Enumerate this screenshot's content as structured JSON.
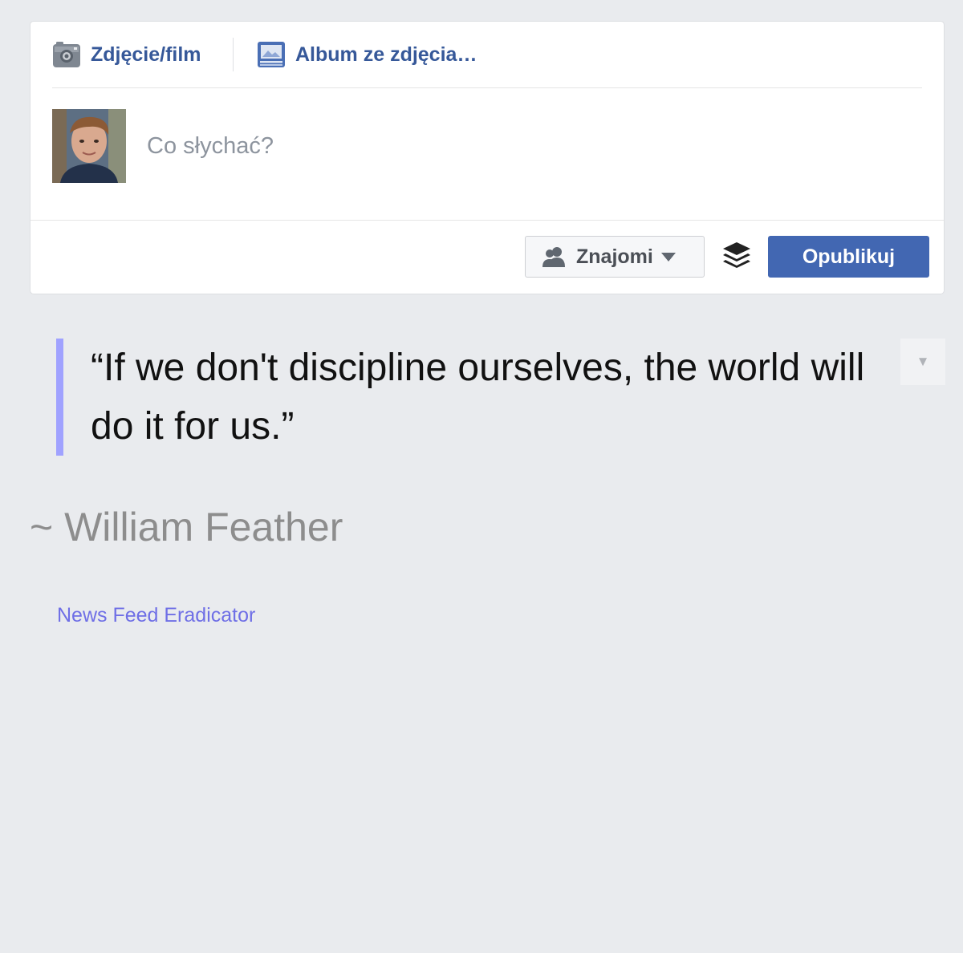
{
  "composer": {
    "tabs": [
      {
        "label": "Zdjęcie/film",
        "icon": "camera-icon"
      },
      {
        "label": "Album ze zdjęcia…",
        "icon": "photo-album-icon"
      }
    ],
    "status_placeholder": "Co słychać?",
    "audience_label": "Znajomi",
    "publish_label": "Opublikuj"
  },
  "quote": {
    "text": "“If we don't discipline ourselves, the world will do it for us.”",
    "author": "~ William Feather",
    "menu_glyph": "▼"
  },
  "footer": {
    "credit": "News Feed Eradicator"
  },
  "colors": {
    "page_bg": "#e9ebee",
    "link_blue": "#365899",
    "publish_blue": "#4267b2",
    "quote_border": "#a0a2ff",
    "credit_link": "#6f6fe6"
  }
}
